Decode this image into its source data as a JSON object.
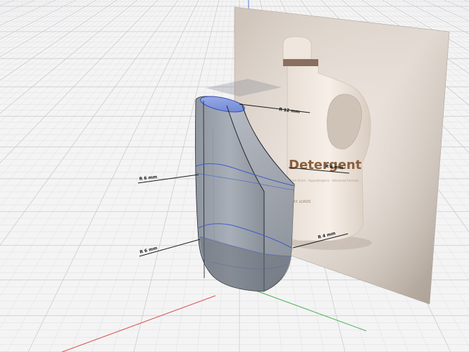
{
  "viewport": {
    "grid_visible": true,
    "colors": {
      "background": "#f4f4f5",
      "grid_minor": "#dcdcdf",
      "grid_major": "#c6c6ca",
      "axis_x": "#d9534f",
      "axis_y": "#4caf50",
      "axis_z": "#5b7fd6",
      "model_edge": "#3d5ccc"
    }
  },
  "reference_image": {
    "brand": "Detergent",
    "subtitle": "Fresh Scent · Hypoallergenic · Advanced Formula",
    "loads": "XX LOADS"
  },
  "dimensions": {
    "top": "R 12 mm",
    "upper_left": "R 6 mm",
    "upper_right": "R 6 mm",
    "lower_left": "R 6 mm",
    "lower_right": "R 4 mm"
  }
}
